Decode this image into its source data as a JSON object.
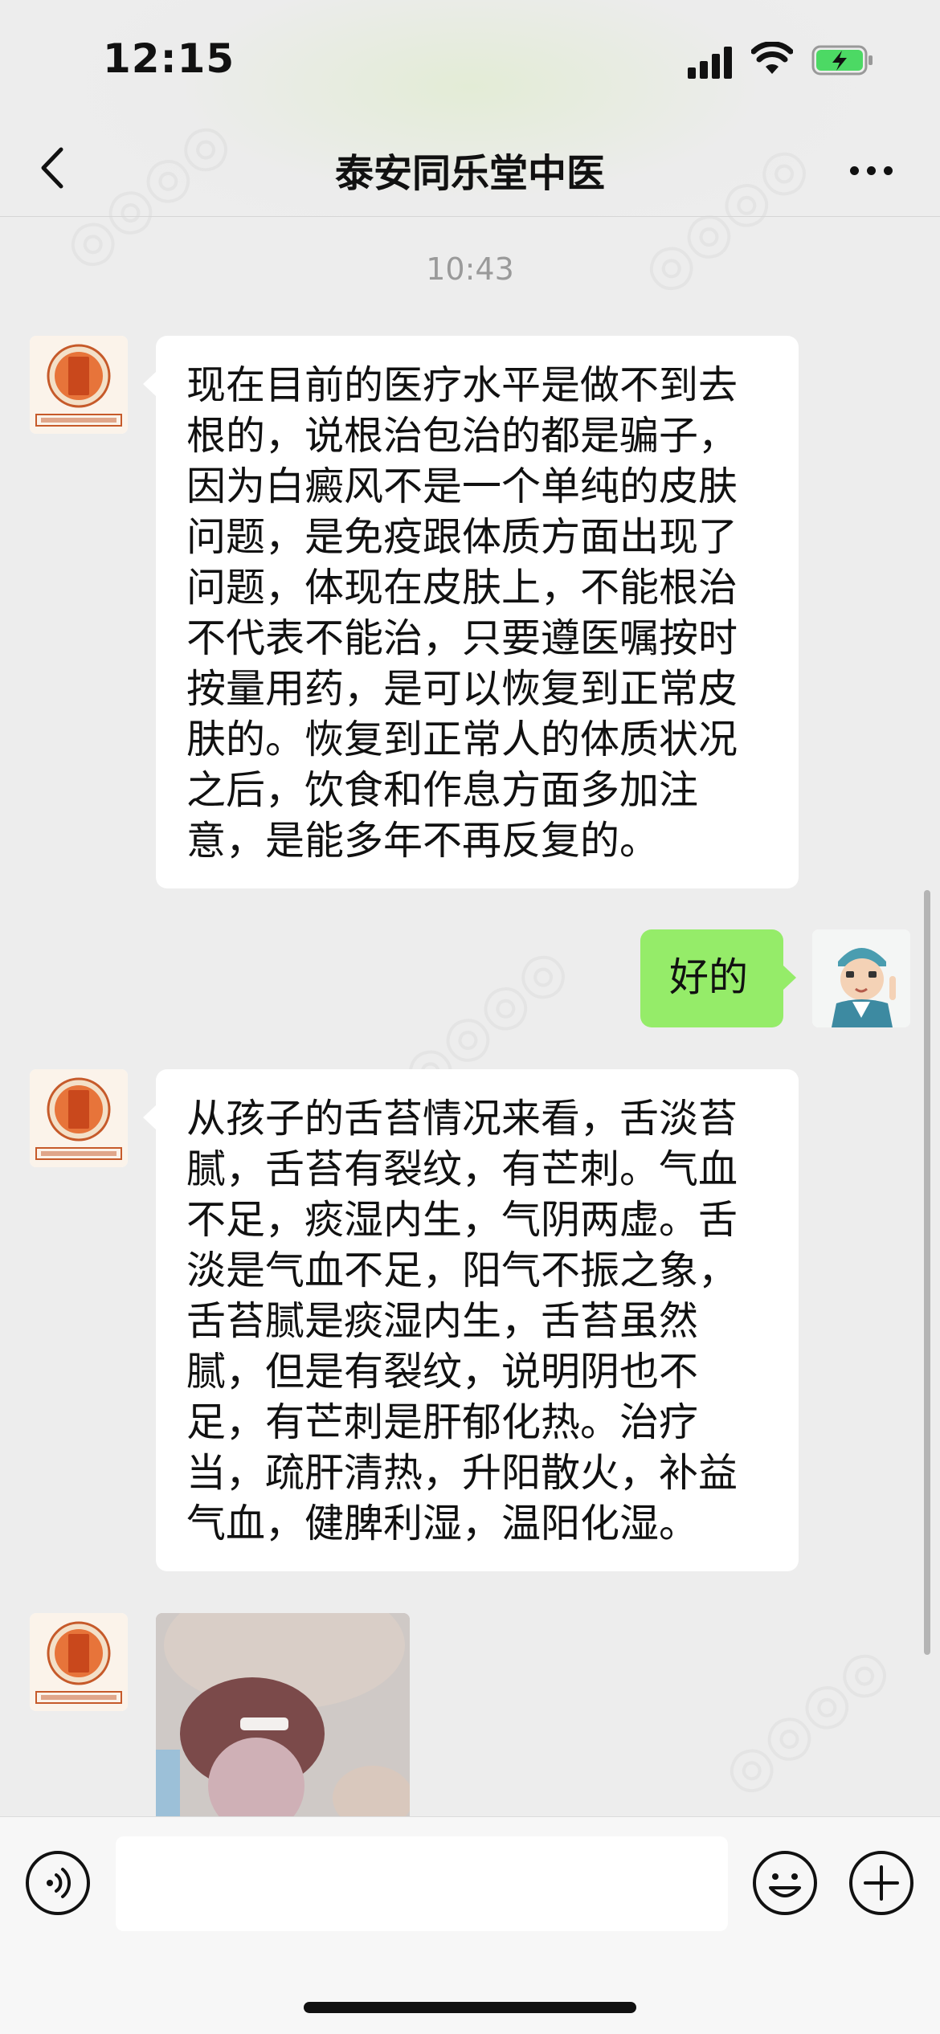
{
  "status_bar": {
    "time": "12:15",
    "icons": [
      "cellular-signal-icon",
      "wifi-icon",
      "battery-charging-icon"
    ],
    "battery_color": "#4cd964"
  },
  "nav": {
    "title": "泰安同乐堂中医",
    "back_icon": "chevron-left-icon",
    "more_icon": "more-dots-icon"
  },
  "chat": {
    "timestamp": "10:43",
    "messages": [
      {
        "side": "left",
        "sender": "clinic",
        "text": "现在目前的医疗水平是做不到去\n根的，说根治包治的都是骗子，\n因为白癜风不是一个单纯的皮肤\n问题，是免疫跟体质方面出现了\n问题，体现在皮肤上，不能根治\n不代表不能治，只要遵医嘱按时\n按量用药，是可以恢复到正常皮\n肤的。恢复到正常人的体质状况\n之后，饮食和作息方面多加注\n意，是能多年不再反复的。"
      },
      {
        "side": "right",
        "sender": "user",
        "text": "好的"
      },
      {
        "side": "left",
        "sender": "clinic",
        "text": "从孩子的舌苔情况来看，舌淡苔\n腻，舌苔有裂纹，有芒刺。气血\n不足，痰湿内生，气阴两虚。舌\n淡是气血不足，阳气不振之象，\n舌苔腻是痰湿内生，舌苔虽然\n腻，但是有裂纹，说明阴也不\n足，有芒刺是肝郁化热。治疗\n当，疏肝清热，升阳散火，补益\n气血，健脾利湿，温阳化湿。"
      },
      {
        "side": "left",
        "sender": "clinic",
        "type": "image",
        "image_desc": "tongue-photo"
      }
    ],
    "clinic_avatar_text": {
      "seal": "同乐堂",
      "caption": "同乐堂中医门诊"
    },
    "bubble_colors": {
      "incoming": "#ffffff",
      "outgoing": "#95ec69"
    }
  },
  "input_bar": {
    "voice_icon": "voice-icon",
    "emoji_icon": "emoji-icon",
    "plus_icon": "plus-icon",
    "input_value": ""
  }
}
